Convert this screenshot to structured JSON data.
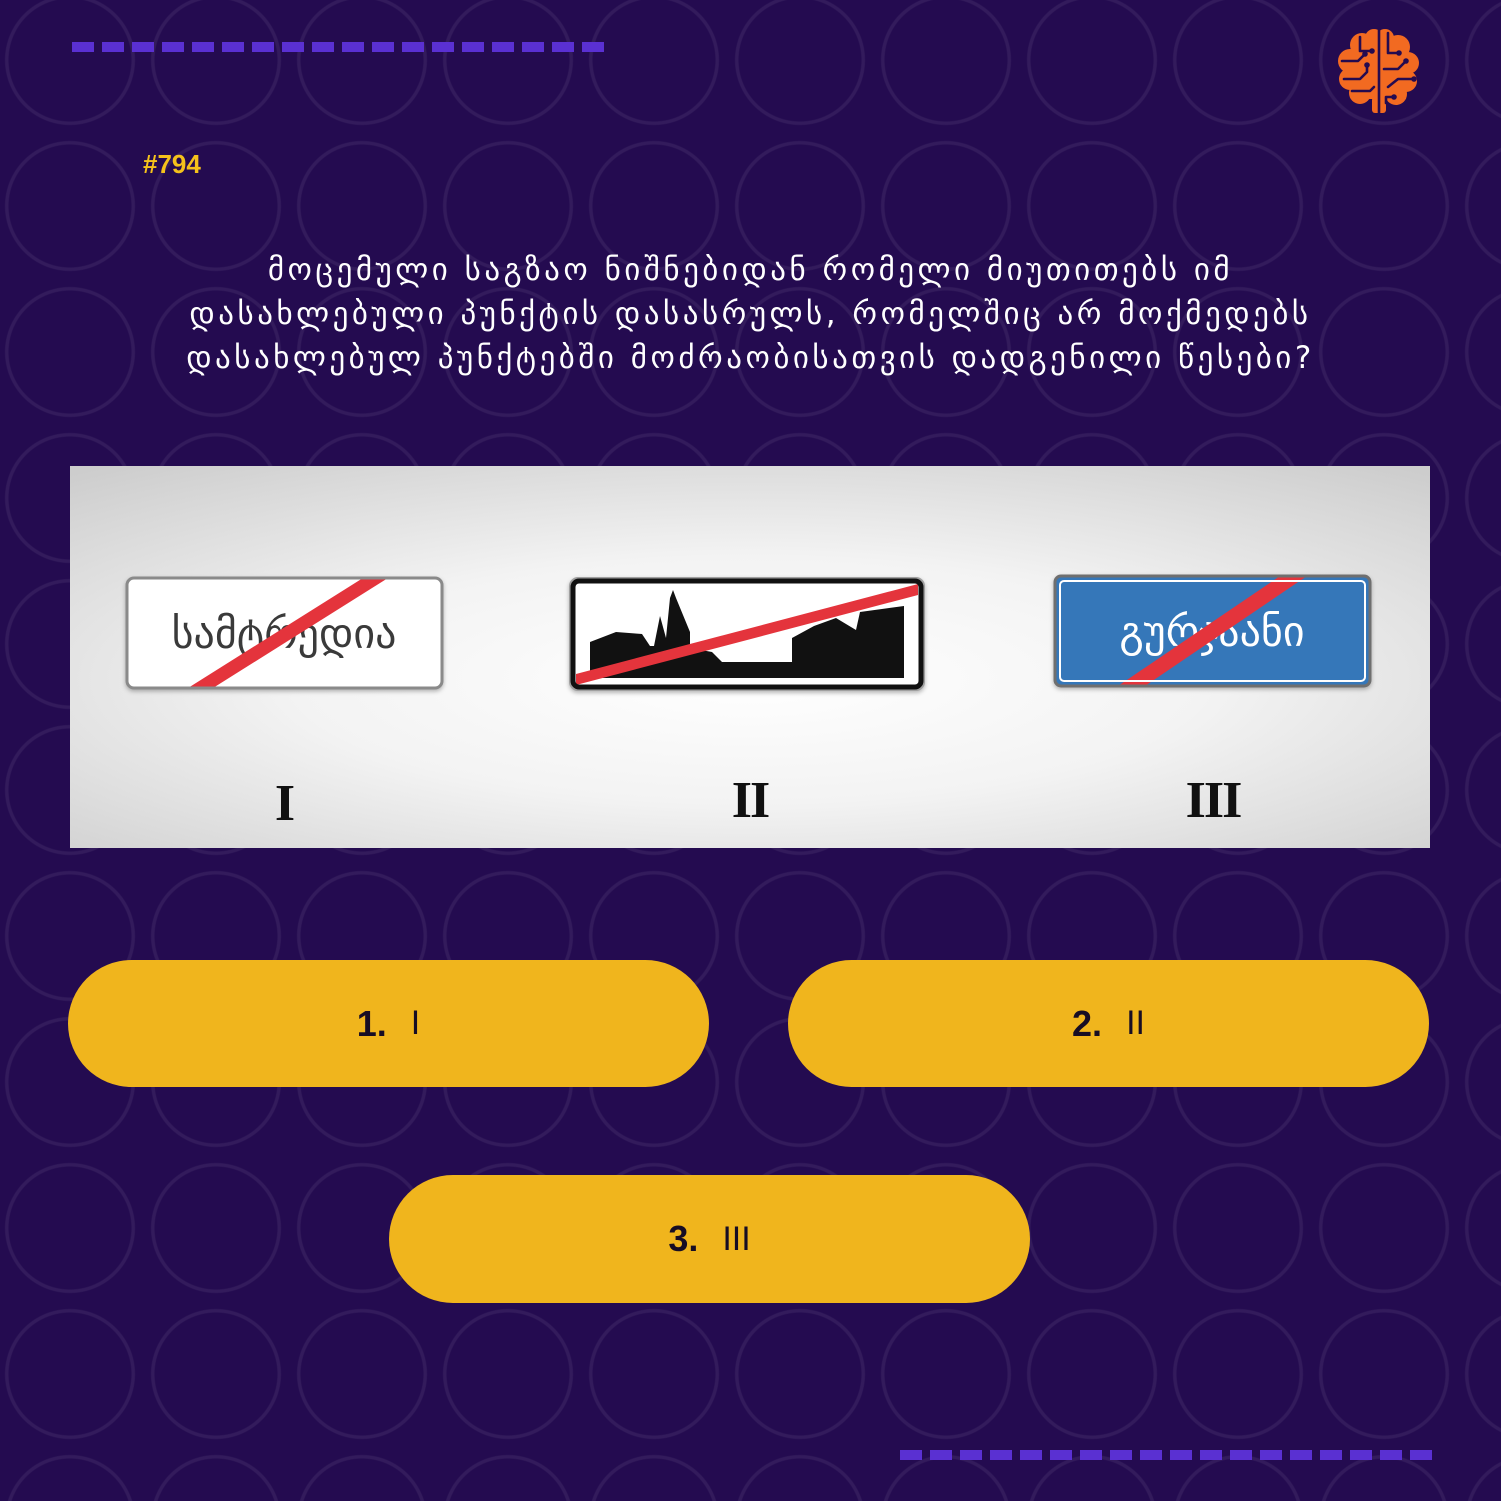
{
  "question_number": "#794",
  "question": {
    "lines": [
      "მოცემული საგზაო ნიშნებიდან რომელი მიუთითებს იმ",
      "დასახლებული პუნქტის დასასრულს, რომელშიც არ მოქმედებს",
      "დასახლებულ პუნქტებში მოძრაობისათვის დადგენილი წესები?"
    ]
  },
  "figure": {
    "signs": [
      {
        "label": "I",
        "text": "სამტრედია"
      },
      {
        "label": "II"
      },
      {
        "label": "III",
        "text": "გურჯაანი"
      }
    ]
  },
  "answers": [
    {
      "number": "1.",
      "label": "I"
    },
    {
      "number": "2.",
      "label": "II"
    },
    {
      "number": "3.",
      "label": "III"
    }
  ],
  "icons": {
    "logo": "brain-circuit-icon"
  },
  "colors": {
    "bg": "#240b50",
    "accent": "#f0b51d",
    "num": "#f5c21b",
    "dash": "#5a30d2",
    "logo": "#f26a21",
    "strike": "#e4343c",
    "signblue": "#3577b9"
  }
}
